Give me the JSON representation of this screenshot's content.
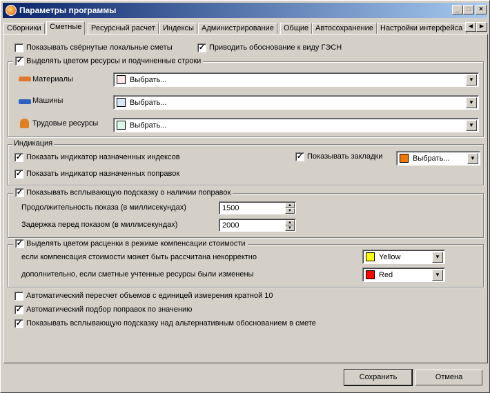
{
  "window": {
    "title": "Параметры программы"
  },
  "tabs": [
    "Сборники",
    "Сметные",
    "Ресурсный расчет",
    "Индексы",
    "Администрирование",
    "Общие",
    "Автосохранение",
    "Настройки интерфейса"
  ],
  "active_tab": "Сметные",
  "top": {
    "show_collapsed": {
      "label": "Показывать свёрнутые локальные сметы",
      "checked": false
    },
    "gesn": {
      "label": "Приводить обоснование к виду ГЭСН",
      "checked": true
    }
  },
  "color_group": {
    "label": "Выделять цветом ресурсы и подчиненные строки",
    "checked": true,
    "rows": [
      {
        "label": "Материалы",
        "value": "Выбрать...",
        "color": "#fce8e8",
        "icon": "bricks-icon"
      },
      {
        "label": "Машины",
        "value": "Выбрать...",
        "color": "#d8e8fa",
        "icon": "truck-icon"
      },
      {
        "label": "Трудовые ресурсы",
        "value": "Выбрать...",
        "color": "#dcf8e8",
        "icon": "worker-icon"
      }
    ]
  },
  "indication": {
    "title": "Индикация",
    "indexes": {
      "label": "Показать индикатор назначенных индексов",
      "checked": true
    },
    "corrections": {
      "label": "Показать индикатор назначенных поправок",
      "checked": true
    },
    "bookmarks": {
      "label": "Показывать закладки",
      "checked": true,
      "value": "Выбрать...",
      "color": "#f07800"
    }
  },
  "tooltip_group": {
    "label": "Показывать всплывающую подсказку о наличии поправок",
    "checked": true,
    "duration_label": "Продолжительность показа (в миллисекундах)",
    "duration": "1500",
    "delay_label": "Задержка перед показом (в миллисекундах)",
    "delay": "2000"
  },
  "compensation": {
    "label": "Выделять цветом расценки в режиме компенсации стоимости",
    "checked": true,
    "row1": {
      "label": "если компенсация стоимости может быть рассчитана некорректно",
      "value": "Yellow",
      "color": "#ffff00"
    },
    "row2": {
      "label": "дополнительно, если сметные учтенные ресурсы были изменены",
      "value": "Red",
      "color": "#ff0000"
    }
  },
  "bottom": [
    {
      "label": "Автоматический пересчет объемов с единицей измерения кратной 10",
      "checked": false
    },
    {
      "label": "Автоматический подбор поправок по значению",
      "checked": true
    },
    {
      "label": "Показывать всплывающую подсказку над альтернативным обоснованием в смете",
      "checked": true
    }
  ],
  "buttons": {
    "save": "Сохранить",
    "cancel": "Отмена"
  }
}
